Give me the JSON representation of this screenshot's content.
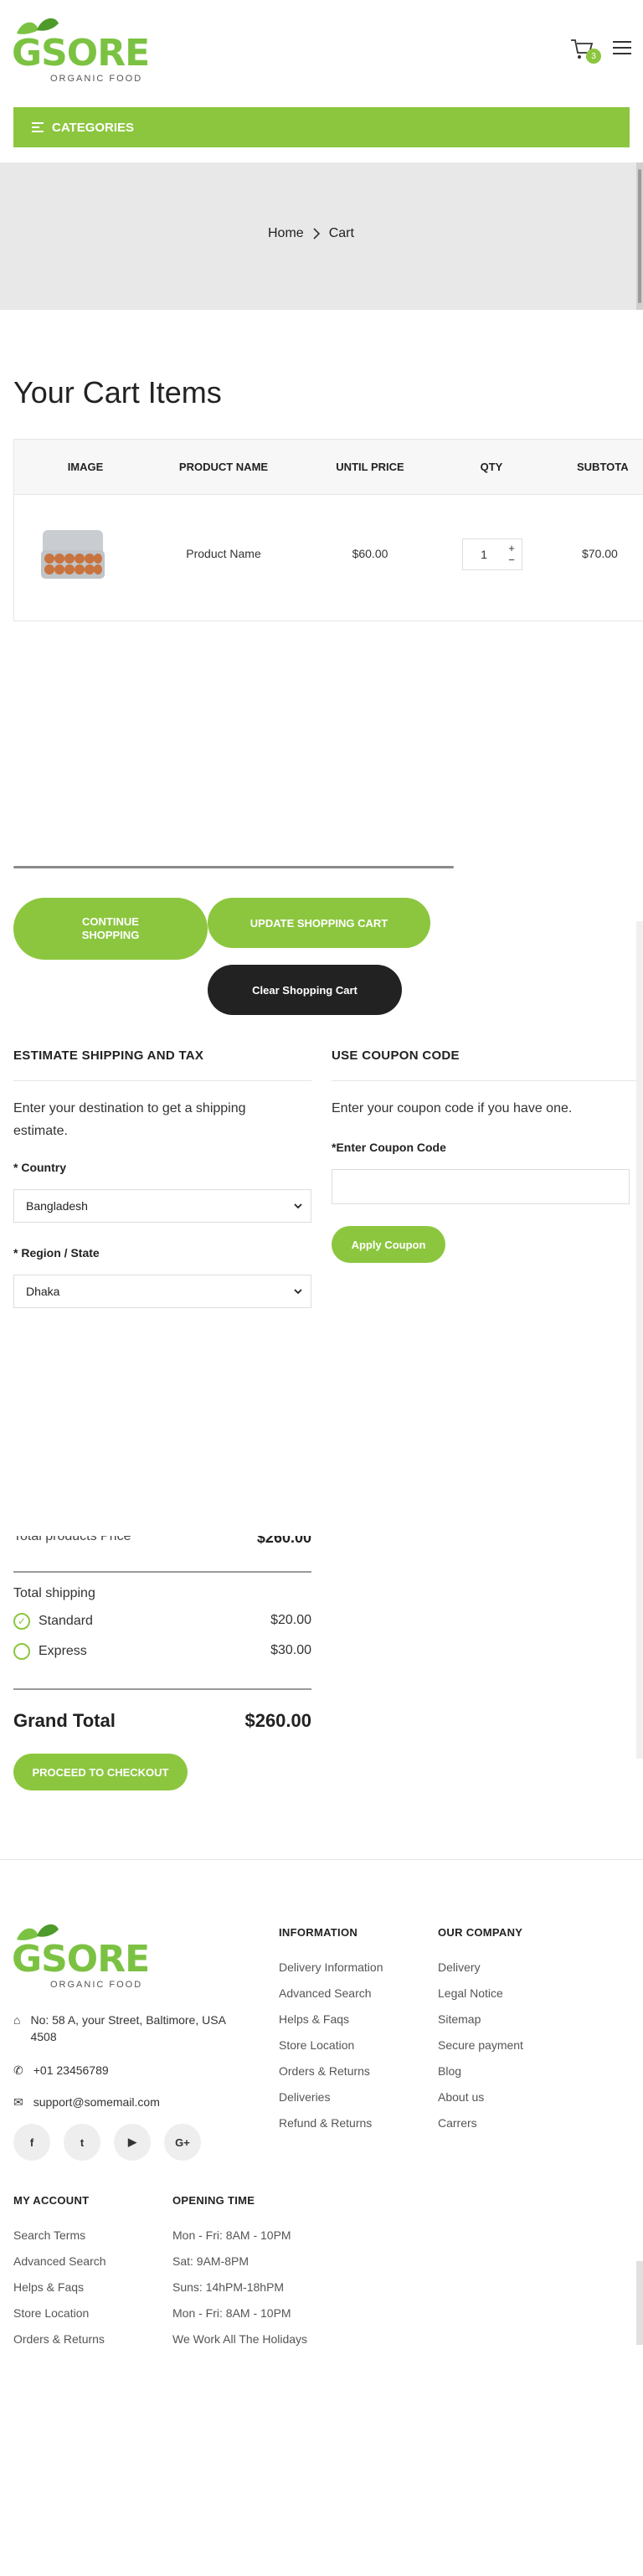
{
  "header": {
    "logo_text": "GSORE",
    "logo_tagline": "ORGANIC FOOD",
    "cart_count": "3",
    "categories_label": "CATEGORIES"
  },
  "breadcrumb": {
    "home": "Home",
    "current": "Cart"
  },
  "page_title": "Your Cart Items",
  "cart": {
    "headers": [
      "IMAGE",
      "PRODUCT NAME",
      "UNTIL PRICE",
      "QTY",
      "SUBTOTA"
    ],
    "rows": [
      {
        "name": "Product Name",
        "price": "$60.00",
        "qty": "1",
        "subtotal": "$70.00"
      }
    ],
    "horizontal_scroll_fraction": 0.7
  },
  "actions": {
    "continue": "CONTINUE SHOPPING",
    "update": "UPDATE SHOPPING CART",
    "clear": "Clear Shopping Cart"
  },
  "shipping": {
    "title": "ESTIMATE SHIPPING AND TAX",
    "desc": "Enter your destination to get a shipping estimate.",
    "country_label": "* Country",
    "country_value": "Bangladesh",
    "region_label": "* Region / State",
    "region_value": "Dhaka"
  },
  "coupon": {
    "title": "USE COUPON CODE",
    "desc": "Enter your coupon code if you have one.",
    "field_label": "*Enter Coupon Code",
    "input_value": "",
    "apply": "Apply Coupon"
  },
  "totals": {
    "products_label": "Total products Price",
    "products_value": "$260.00",
    "shipping_label": "Total shipping",
    "options": [
      {
        "name": "Standard",
        "price": "$20.00",
        "selected": true
      },
      {
        "name": "Express",
        "price": "$30.00",
        "selected": false
      }
    ],
    "grand_label": "Grand Total",
    "grand_value": "$260.00",
    "checkout": "PROCEED TO CHECKOUT"
  },
  "footer": {
    "address": "No: 58 A, your Street, Baltimore, USA 4508",
    "phone": "+01 23456789",
    "email": "support@somemail.com",
    "social": [
      "f",
      "t",
      "▶",
      "G+"
    ],
    "information": {
      "title": "INFORMATION",
      "links": [
        "Delivery Information",
        "Advanced Search",
        "Helps & Faqs",
        "Store Location",
        "Orders & Returns",
        "Deliveries",
        "Refund & Returns"
      ]
    },
    "company": {
      "title": "OUR COMPANY",
      "links": [
        "Delivery",
        "Legal Notice",
        "Sitemap",
        "Secure payment",
        "Blog",
        "About us",
        "Carrers"
      ]
    },
    "account": {
      "title": "MY ACCOUNT",
      "links": [
        "Search Terms",
        "Advanced Search",
        "Helps & Faqs",
        "Store Location",
        "Orders & Returns"
      ]
    },
    "opening": {
      "title": "OPENING TIME",
      "lines": [
        "Mon - Fri: 8AM - 10PM",
        "Sat: 9AM-8PM",
        "Suns: 14hPM-18hPM",
        "Mon - Fri: 8AM - 10PM",
        "We Work All The Holidays"
      ]
    }
  },
  "colors": {
    "accent": "#8cc63f",
    "dark": "#222222"
  }
}
